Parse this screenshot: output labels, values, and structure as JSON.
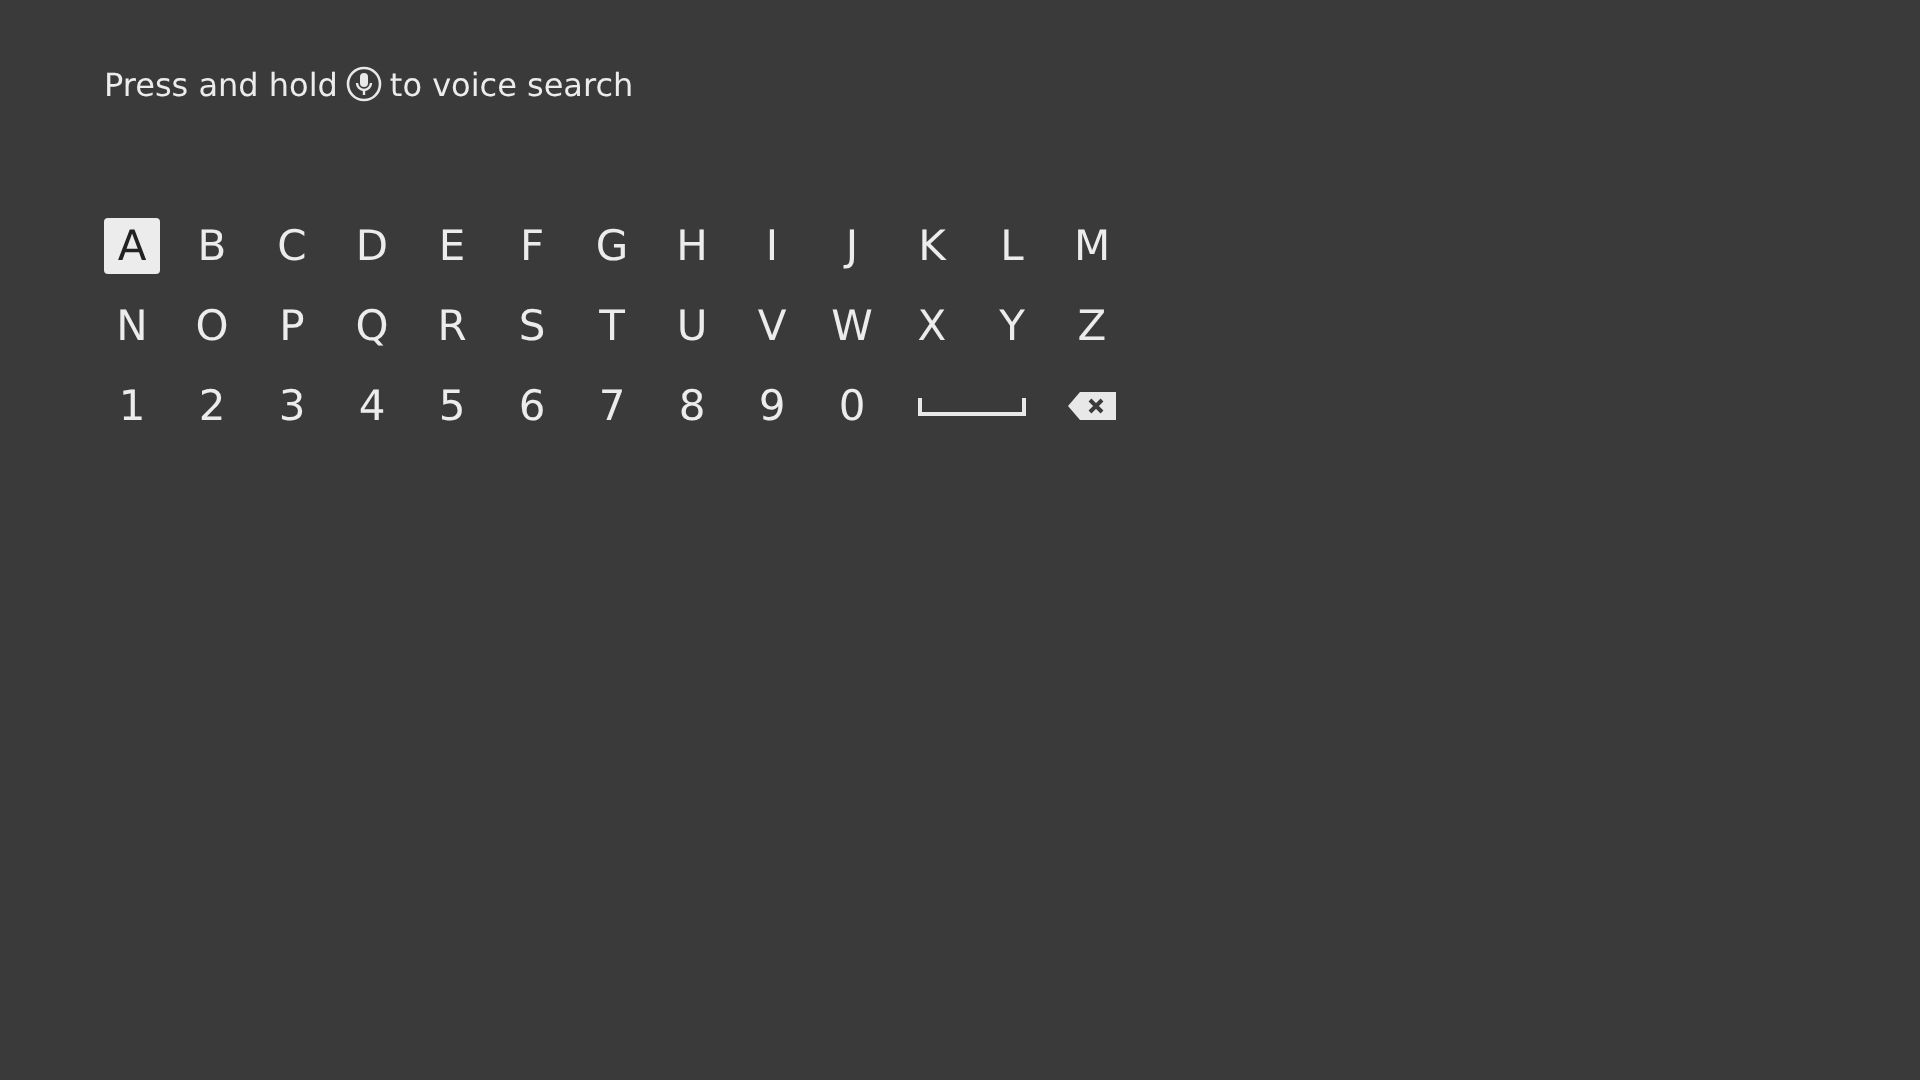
{
  "hint": {
    "before": "Press and hold",
    "after": "to voice search"
  },
  "keys": [
    {
      "kind": "char",
      "label": "A",
      "selected": true
    },
    {
      "kind": "char",
      "label": "B",
      "selected": false
    },
    {
      "kind": "char",
      "label": "C",
      "selected": false
    },
    {
      "kind": "char",
      "label": "D",
      "selected": false
    },
    {
      "kind": "char",
      "label": "E",
      "selected": false
    },
    {
      "kind": "char",
      "label": "F",
      "selected": false
    },
    {
      "kind": "char",
      "label": "G",
      "selected": false
    },
    {
      "kind": "char",
      "label": "H",
      "selected": false
    },
    {
      "kind": "char",
      "label": "I",
      "selected": false
    },
    {
      "kind": "char",
      "label": "J",
      "selected": false
    },
    {
      "kind": "char",
      "label": "K",
      "selected": false
    },
    {
      "kind": "char",
      "label": "L",
      "selected": false
    },
    {
      "kind": "char",
      "label": "M",
      "selected": false
    },
    {
      "kind": "char",
      "label": "N",
      "selected": false
    },
    {
      "kind": "char",
      "label": "O",
      "selected": false
    },
    {
      "kind": "char",
      "label": "P",
      "selected": false
    },
    {
      "kind": "char",
      "label": "Q",
      "selected": false
    },
    {
      "kind": "char",
      "label": "R",
      "selected": false
    },
    {
      "kind": "char",
      "label": "S",
      "selected": false
    },
    {
      "kind": "char",
      "label": "T",
      "selected": false
    },
    {
      "kind": "char",
      "label": "U",
      "selected": false
    },
    {
      "kind": "char",
      "label": "V",
      "selected": false
    },
    {
      "kind": "char",
      "label": "W",
      "selected": false
    },
    {
      "kind": "char",
      "label": "X",
      "selected": false
    },
    {
      "kind": "char",
      "label": "Y",
      "selected": false
    },
    {
      "kind": "char",
      "label": "Z",
      "selected": false
    },
    {
      "kind": "char",
      "label": "1",
      "selected": false
    },
    {
      "kind": "char",
      "label": "2",
      "selected": false
    },
    {
      "kind": "char",
      "label": "3",
      "selected": false
    },
    {
      "kind": "char",
      "label": "4",
      "selected": false
    },
    {
      "kind": "char",
      "label": "5",
      "selected": false
    },
    {
      "kind": "char",
      "label": "6",
      "selected": false
    },
    {
      "kind": "char",
      "label": "7",
      "selected": false
    },
    {
      "kind": "char",
      "label": "8",
      "selected": false
    },
    {
      "kind": "char",
      "label": "9",
      "selected": false
    },
    {
      "kind": "char",
      "label": "0",
      "selected": false
    },
    {
      "kind": "space",
      "selected": false
    },
    {
      "kind": "backspace",
      "selected": false
    }
  ]
}
